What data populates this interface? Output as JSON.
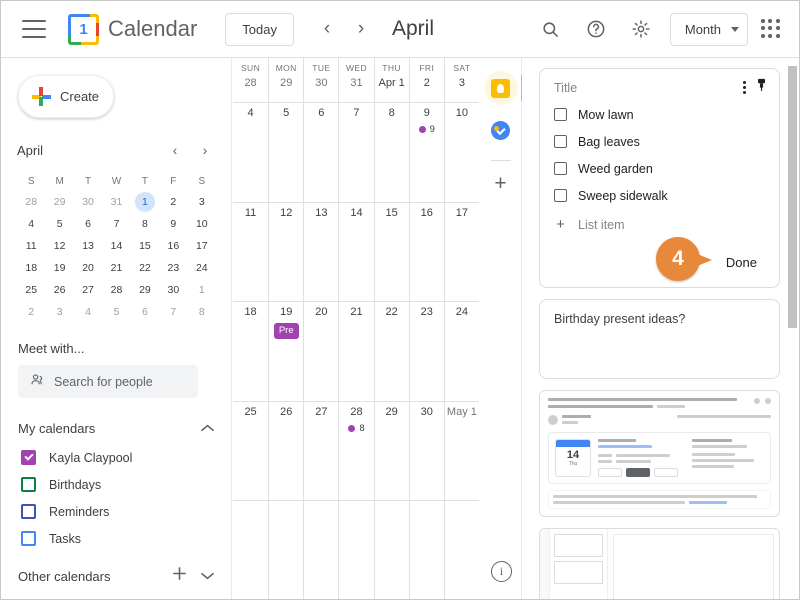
{
  "header": {
    "menu_icon": "hamburger-menu-icon",
    "logo_day": "1",
    "brand": "Calendar",
    "today_label": "Today",
    "prev_label": "‹",
    "next_label": "›",
    "month_title": "April",
    "search_icon": "search-icon",
    "help_icon": "help-icon",
    "settings_icon": "gear-icon",
    "view_label": "Month",
    "apps_icon": "apps-grid-icon"
  },
  "sidebar": {
    "create_label": "Create",
    "mini_calendar": {
      "month": "April",
      "prev": "‹",
      "next": "›",
      "dow": [
        "S",
        "M",
        "T",
        "W",
        "T",
        "F",
        "S"
      ],
      "weeks": [
        [
          {
            "n": "28",
            "muted": true
          },
          {
            "n": "29",
            "muted": true
          },
          {
            "n": "30",
            "muted": true
          },
          {
            "n": "31",
            "muted": true
          },
          {
            "n": "1",
            "today": true
          },
          {
            "n": "2"
          },
          {
            "n": "3"
          }
        ],
        [
          {
            "n": "4"
          },
          {
            "n": "5"
          },
          {
            "n": "6"
          },
          {
            "n": "7"
          },
          {
            "n": "8"
          },
          {
            "n": "9"
          },
          {
            "n": "10"
          }
        ],
        [
          {
            "n": "11"
          },
          {
            "n": "12"
          },
          {
            "n": "13"
          },
          {
            "n": "14"
          },
          {
            "n": "15"
          },
          {
            "n": "16"
          },
          {
            "n": "17"
          }
        ],
        [
          {
            "n": "18"
          },
          {
            "n": "19"
          },
          {
            "n": "20"
          },
          {
            "n": "21"
          },
          {
            "n": "22"
          },
          {
            "n": "23"
          },
          {
            "n": "24"
          }
        ],
        [
          {
            "n": "25"
          },
          {
            "n": "26"
          },
          {
            "n": "27"
          },
          {
            "n": "28"
          },
          {
            "n": "29"
          },
          {
            "n": "30"
          },
          {
            "n": "1",
            "muted": true
          }
        ],
        [
          {
            "n": "2",
            "muted": true
          },
          {
            "n": "3",
            "muted": true
          },
          {
            "n": "4",
            "muted": true
          },
          {
            "n": "5",
            "muted": true
          },
          {
            "n": "6",
            "muted": true
          },
          {
            "n": "7",
            "muted": true
          },
          {
            "n": "8",
            "muted": true
          }
        ]
      ]
    },
    "meet_with_label": "Meet with...",
    "search_people_placeholder": "Search for people",
    "my_calendars_label": "My calendars",
    "my_calendars": [
      {
        "name": "Kayla Claypool",
        "color": "#a142b0",
        "checked": true
      },
      {
        "name": "Birthdays",
        "color": "#0b8043",
        "checked": false
      },
      {
        "name": "Reminders",
        "color": "#3f51b5",
        "checked": false
      },
      {
        "name": "Tasks",
        "color": "#4285f4",
        "checked": false
      }
    ],
    "other_calendars_label": "Other calendars",
    "add_other_icon": "plus-icon",
    "expand_other_icon": "chevron-down-icon"
  },
  "grid": {
    "header": [
      {
        "dow": "SUN",
        "num": "28",
        "muted": true
      },
      {
        "dow": "MON",
        "num": "29",
        "muted": true
      },
      {
        "dow": "TUE",
        "num": "30",
        "muted": true
      },
      {
        "dow": "WED",
        "num": "31",
        "muted": true
      },
      {
        "dow": "THU",
        "num": "Apr 1",
        "muted": false
      },
      {
        "dow": "FRI",
        "num": "2",
        "muted": false
      },
      {
        "dow": "SAT",
        "num": "3",
        "muted": false
      }
    ],
    "rows": [
      [
        {
          "num": "4"
        },
        {
          "num": "5"
        },
        {
          "num": "6"
        },
        {
          "num": "7"
        },
        {
          "num": "8"
        },
        {
          "num": "9",
          "event_dot_label": "9"
        },
        {
          "num": "10"
        }
      ],
      [
        {
          "num": "11"
        },
        {
          "num": "12"
        },
        {
          "num": "13"
        },
        {
          "num": "14"
        },
        {
          "num": "15"
        },
        {
          "num": "16"
        },
        {
          "num": "17"
        }
      ],
      [
        {
          "num": "18"
        },
        {
          "num": "19",
          "event_chip": "Pre"
        },
        {
          "num": "20"
        },
        {
          "num": "21"
        },
        {
          "num": "22"
        },
        {
          "num": "23"
        },
        {
          "num": "24"
        }
      ],
      [
        {
          "num": "25"
        },
        {
          "num": "26"
        },
        {
          "num": "27"
        },
        {
          "num": "28",
          "event_dot_label": "8"
        },
        {
          "num": "29"
        },
        {
          "num": "30"
        },
        {
          "num": "May 1",
          "muted": true
        }
      ],
      [
        {
          "num": ""
        },
        {
          "num": ""
        },
        {
          "num": ""
        },
        {
          "num": ""
        },
        {
          "num": ""
        },
        {
          "num": ""
        },
        {
          "num": ""
        }
      ]
    ]
  },
  "side_strip": {
    "keep_icon": "google-keep-icon",
    "tasks_icon": "google-tasks-icon",
    "add_icon": "plus-icon",
    "info_icon": "info-icon"
  },
  "keep_panel": {
    "note": {
      "title_placeholder": "Title",
      "menu_icon": "more-options-icon",
      "pin_icon": "pin-icon",
      "items": [
        "Mow lawn",
        "Bag leaves",
        "Weed garden",
        "Sweep sidewalk"
      ],
      "add_item_label": "List item",
      "done_label": "Done"
    },
    "second_note": {
      "text": "Birthday present ideas?"
    }
  },
  "callout": {
    "number": "4"
  }
}
